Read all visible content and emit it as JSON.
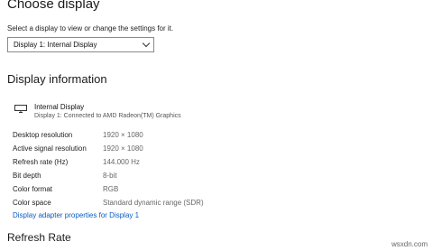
{
  "choose": {
    "title": "Choose display",
    "subtitle": "Select a display to view or change the settings for it.",
    "selected": "Display 1: Internal Display"
  },
  "info": {
    "title": "Display information",
    "display_name": "Internal Display",
    "display_sub": "Display 1: Connected to AMD Radeon(TM) Graphics",
    "rows": [
      {
        "label": "Desktop resolution",
        "value": "1920 × 1080"
      },
      {
        "label": "Active signal resolution",
        "value": "1920 × 1080"
      },
      {
        "label": "Refresh rate (Hz)",
        "value": "144.000 Hz"
      },
      {
        "label": "Bit depth",
        "value": "8-bit"
      },
      {
        "label": "Color format",
        "value": "RGB"
      },
      {
        "label": "Color space",
        "value": "Standard dynamic range (SDR)"
      }
    ],
    "link": "Display adapter properties for Display 1"
  },
  "refresh": {
    "title": "Refresh Rate"
  },
  "watermark": "wsxdn.com",
  "colors": {
    "link": "#0a5cc2",
    "accent": "#0a5cc2"
  },
  "icons": {
    "monitor": "monitor-icon",
    "dropdown": "chevron-down-icon"
  }
}
